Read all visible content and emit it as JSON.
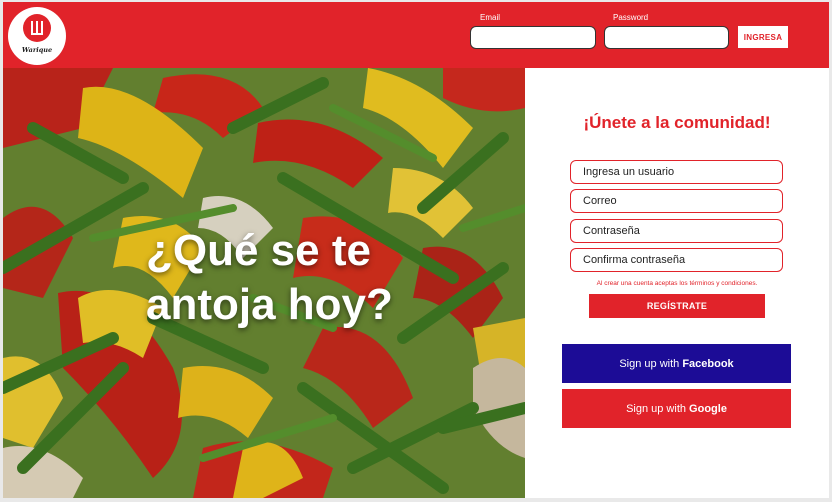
{
  "brand": {
    "logo_text": "Warique",
    "accent": "#e1232a",
    "facebook_color": "#1c0c96"
  },
  "header": {
    "email_label": "Email",
    "password_label": "Password",
    "email_value": "",
    "password_value": "",
    "login_button": "INGRESA"
  },
  "hero": {
    "line1": "¿Qué se te",
    "line2": "antoja hoy?"
  },
  "register": {
    "title": "¡Únete a la comunidad!",
    "username_placeholder": "Ingresa un usuario",
    "email_placeholder": "Correo",
    "password_placeholder": "Contraseña",
    "confirm_placeholder": "Confirma contraseña",
    "terms": "Al crear una cuenta aceptas los términos y condiciones.",
    "submit": "REGÍSTRATE"
  },
  "social": {
    "facebook_prefix": "Sign up with ",
    "facebook_brand": "Facebook",
    "google_prefix": "Sign up with ",
    "google_brand": "Google"
  }
}
